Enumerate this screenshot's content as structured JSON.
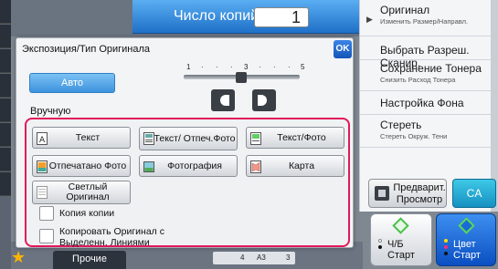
{
  "copies": {
    "label": "Число копий",
    "value": "1"
  },
  "right_menu": [
    {
      "title": "Оригинал",
      "subtitle": "Изменить Размер/Направл."
    },
    {
      "title": "Выбрать Разреш. Сканир.",
      "subtitle": ""
    },
    {
      "title": "Сохранение Тонера",
      "subtitle": "Снизить Расход Тонера"
    },
    {
      "title": "Настройка Фона",
      "subtitle": ""
    },
    {
      "title": "Стереть",
      "subtitle": "Стереть Окруж. Тени"
    }
  ],
  "preview_label": "Предварит. Просмотр",
  "ca_label": "CA",
  "start_bw": {
    "line1": "Ч/Б",
    "line2": "Старт"
  },
  "start_color": {
    "line1": "Цвет",
    "line2": "Старт"
  },
  "other_label": "Прочие",
  "paper": {
    "left": "4",
    "size": "A3",
    "right": "3"
  },
  "dialog": {
    "title": "Экспозиция/Тип Оригинала",
    "ok_label": "OK",
    "auto_label": "Авто",
    "manual_label": "Вручную",
    "scale": [
      "1",
      "·",
      "·",
      "·",
      "3",
      "·",
      "·",
      "·",
      "5"
    ],
    "exposure_level": 3,
    "types": [
      {
        "label": "Текст",
        "icon": "text-icon"
      },
      {
        "label": "Текст/ Отпеч.Фото",
        "icon": "text-printed-photo-icon"
      },
      {
        "label": "Текст/Фото",
        "icon": "text-photo-icon"
      },
      {
        "label": "Отпечатано Фото",
        "icon": "printed-photo-icon"
      },
      {
        "label": "Фотография",
        "icon": "photograph-icon"
      },
      {
        "label": "Карта",
        "icon": "map-icon"
      },
      {
        "label": "Светлый Оригинал",
        "icon": "light-original-icon"
      }
    ],
    "checkboxes": [
      {
        "label": "Копия копии",
        "checked": false
      },
      {
        "label": "Копировать Оригинал с Выделенн. Линиями",
        "checked": false
      }
    ]
  },
  "colors": {
    "accent_blue": "#1f70c8",
    "highlight_frame": "#e2195a",
    "start_green": "#4cc04c"
  }
}
